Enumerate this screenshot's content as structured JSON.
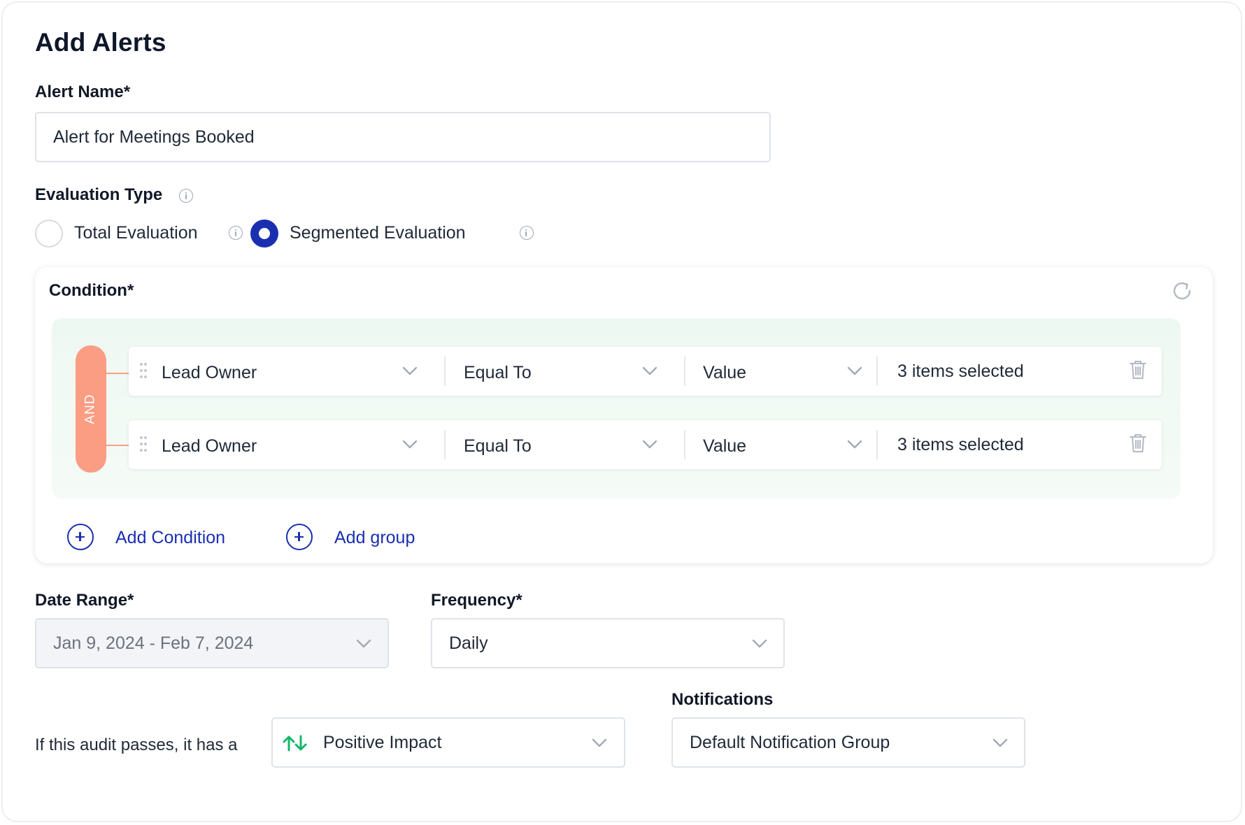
{
  "page": {
    "title": "Add Alerts"
  },
  "alert_name": {
    "label": "Alert Name*",
    "value": "Alert for Meetings Booked"
  },
  "evaluation": {
    "label": "Evaluation Type",
    "options": [
      {
        "label": "Total Evaluation",
        "selected": false
      },
      {
        "label": "Segmented Evaluation",
        "selected": true
      }
    ]
  },
  "condition": {
    "label": "Condition*",
    "operator": "AND",
    "rows": [
      {
        "field": "Lead Owner",
        "comparator": "Equal To",
        "type": "Value",
        "selection": "3 items selected"
      },
      {
        "field": "Lead Owner",
        "comparator": "Equal To",
        "type": "Value",
        "selection": "3 items selected"
      }
    ],
    "add_condition": "Add Condition",
    "add_group": "Add group"
  },
  "date_range": {
    "label": "Date Range*",
    "value": "Jan 9, 2024 - Feb 7, 2024"
  },
  "frequency": {
    "label": "Frequency*",
    "value": "Daily"
  },
  "impact": {
    "prefix": "If this audit passes, it has a",
    "value": "Positive Impact"
  },
  "notifications": {
    "label": "Notifications",
    "value": "Default Notification Group"
  },
  "colors": {
    "primary": "#1a2fb0",
    "and_pill": "#fa9d83",
    "impact_icon": "#12b76a",
    "condition_bg": "#eef8f2"
  },
  "icons": [
    "info-icon",
    "refresh-icon",
    "drag-handle-icon",
    "chevron-down-icon",
    "trash-icon",
    "plus-circle-icon",
    "sort-arrows-icon"
  ]
}
